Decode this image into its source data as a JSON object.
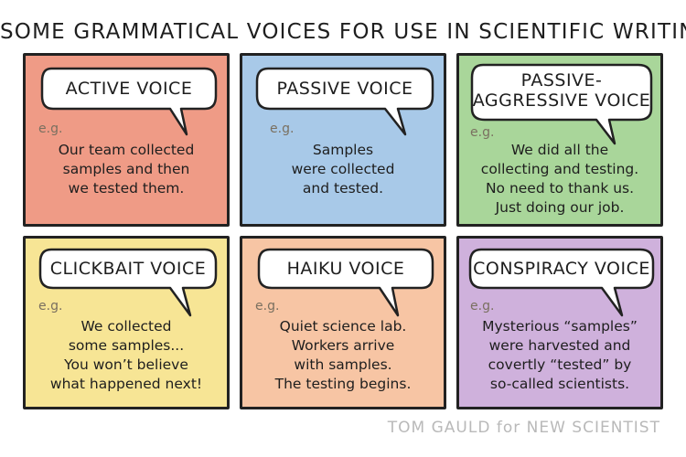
{
  "title": "SOME GRAMMATICAL VOICES FOR USE IN SCIENTIFIC WRITING",
  "eg_label": "e.g.",
  "panels": [
    {
      "heading": "ACTIVE VOICE",
      "color": "#ef9b86",
      "example": "Our team collected\nsamples and then\nwe tested them."
    },
    {
      "heading": "PASSIVE VOICE",
      "color": "#a8c9e8",
      "example": "Samples\nwere collected\nand tested."
    },
    {
      "heading": "PASSIVE-\nAGGRESSIVE VOICE",
      "color": "#a9d69a",
      "example": "We did all the\ncollecting and testing.\nNo need to thank us.\nJust doing our job."
    },
    {
      "heading": "CLICKBAIT VOICE",
      "color": "#f7e595",
      "example": "We collected\nsome samples...\nYou won’t believe\nwhat happened next!"
    },
    {
      "heading": "HAIKU VOICE",
      "color": "#f7c5a4",
      "example": "Quiet science lab.\nWorkers arrive\nwith samples.\nThe testing begins."
    },
    {
      "heading": "CONSPIRACY VOICE",
      "color": "#cfb1dc",
      "example": "Mysterious “samples”\nwere harvested and\ncovertly “tested” by\nso-called scientists."
    }
  ],
  "credit": {
    "part1": "TOM GAULD",
    "part2": "for",
    "part3": "NEW SCIENTIST"
  }
}
